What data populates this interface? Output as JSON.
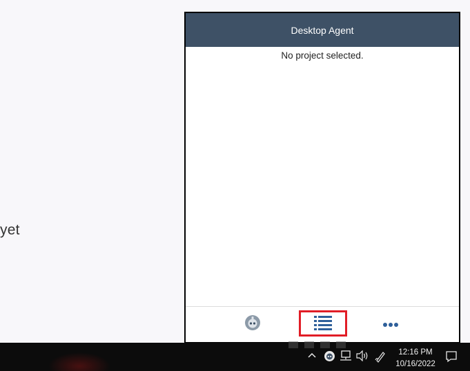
{
  "background": {
    "partial_text": "yet"
  },
  "agent": {
    "title": "Desktop Agent",
    "message": "No project selected.",
    "footer": {
      "items": [
        {
          "name": "robot",
          "icon": "robot-avatar-icon"
        },
        {
          "name": "list",
          "icon": "list-icon",
          "selected": true
        },
        {
          "name": "more",
          "icon": "more-dots-icon"
        }
      ]
    }
  },
  "taskbar": {
    "time": "12:16 PM",
    "date": "10/16/2022"
  },
  "colors": {
    "header": "#3e5166",
    "accent": "#2e5f9a",
    "highlight": "#e11d26"
  }
}
